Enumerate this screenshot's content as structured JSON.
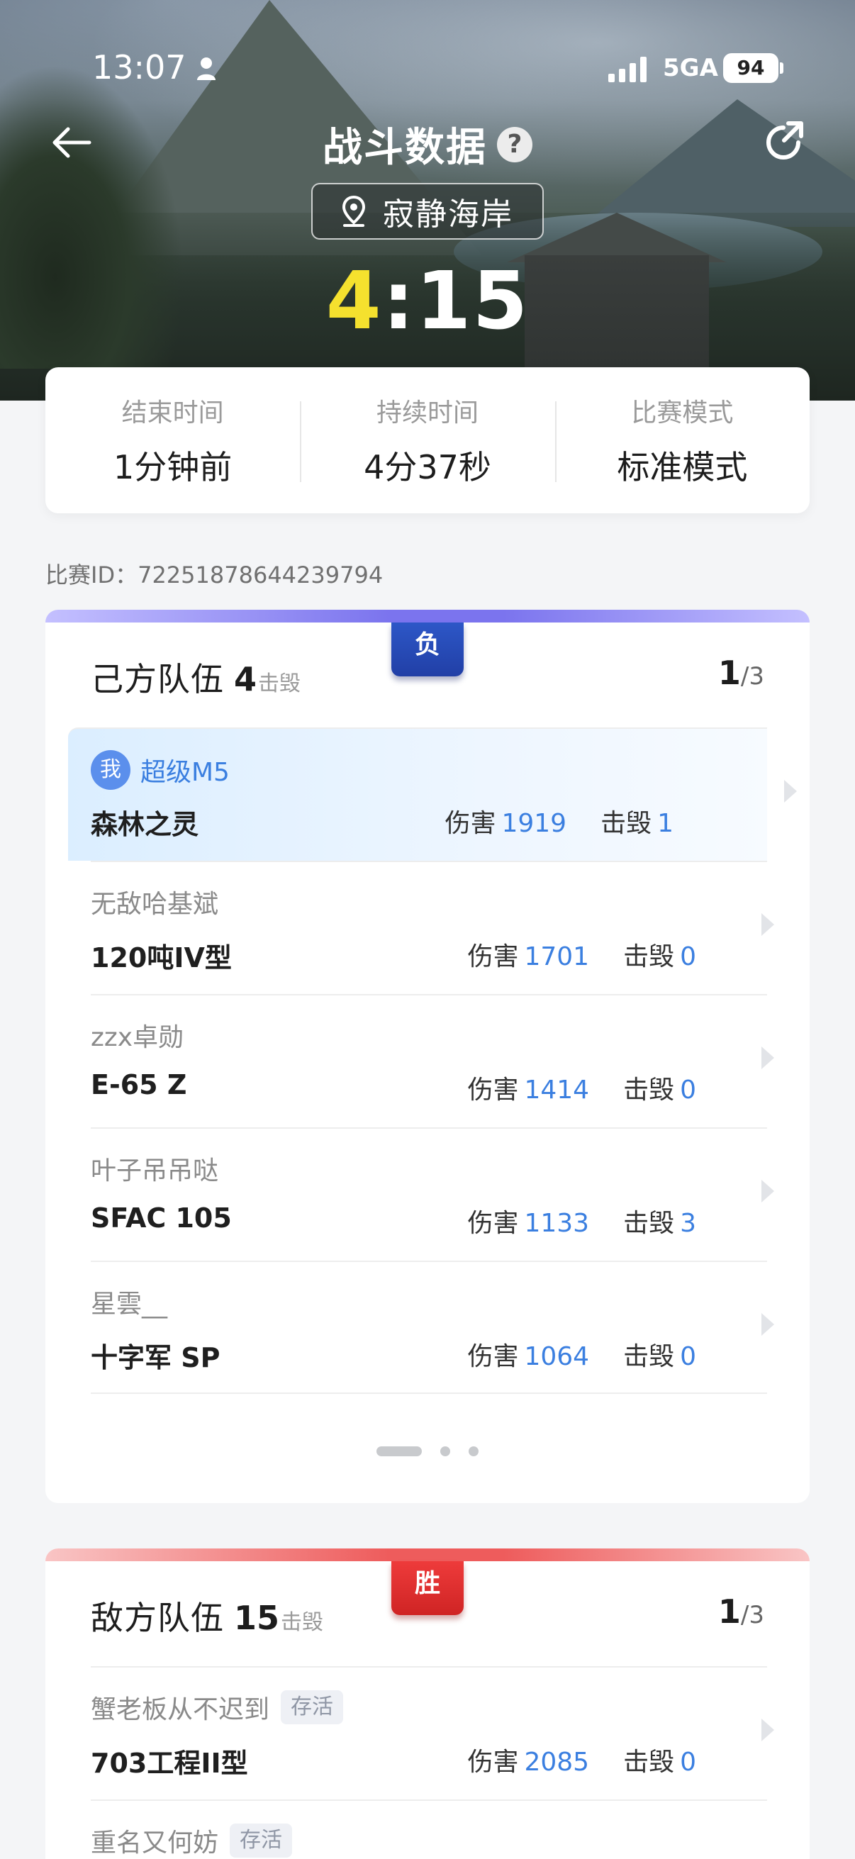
{
  "status_bar": {
    "time": "13:07",
    "network": "5GA",
    "battery": "94"
  },
  "header": {
    "title": "战斗数据",
    "help_icon": "?",
    "map_name": "寂静海岸"
  },
  "score": {
    "own": "4",
    "separator": ":",
    "enemy": "15"
  },
  "summary": [
    {
      "label": "结束时间",
      "value": "1分钟前"
    },
    {
      "label": "持续时间",
      "value": "4分37秒"
    },
    {
      "label": "比赛模式",
      "value": "标准模式"
    }
  ],
  "match_id": "比赛ID：72251878644239794",
  "own_team": {
    "name": "己方队伍",
    "kills": "4",
    "kills_unit": "击毁",
    "result": "负",
    "page": "1",
    "page_total": "/3",
    "players": [
      {
        "me_tag": "我",
        "player": "超级M5",
        "tank": "森林之灵",
        "damage_label": "伤害",
        "damage": "1919",
        "kills_label": "击毁",
        "kills": "1"
      },
      {
        "player": "无敌哈基斌",
        "tank": "120吨IV型",
        "damage_label": "伤害",
        "damage": "1701",
        "kills_label": "击毁",
        "kills": "0"
      },
      {
        "player": "zzx卓勋",
        "tank": "E-65 Z",
        "damage_label": "伤害",
        "damage": "1414",
        "kills_label": "击毁",
        "kills": "0"
      },
      {
        "player": "叶子吊吊哒",
        "tank": "SFAC 105",
        "damage_label": "伤害",
        "damage": "1133",
        "kills_label": "击毁",
        "kills": "3"
      },
      {
        "player": "星雲__",
        "tank": "十字军 SP",
        "damage_label": "伤害",
        "damage": "1064",
        "kills_label": "击毁",
        "kills": "0"
      }
    ]
  },
  "enemy_team": {
    "name": "敌方队伍",
    "kills": "15",
    "kills_unit": "击毁",
    "result": "胜",
    "page": "1",
    "page_total": "/3",
    "players": [
      {
        "player": "蟹老板从不迟到",
        "alive_tag": "存活",
        "tank": "703工程II型",
        "damage_label": "伤害",
        "damage": "2085",
        "kills_label": "击毁",
        "kills": "0"
      },
      {
        "player": "重名又何妨",
        "alive_tag": "存活"
      }
    ]
  },
  "colors": {
    "own_score": "#f5e12e",
    "accent_blue": "#3b7fe0",
    "defeat_badge": "#213fa6",
    "victory_badge": "#cf2424"
  }
}
